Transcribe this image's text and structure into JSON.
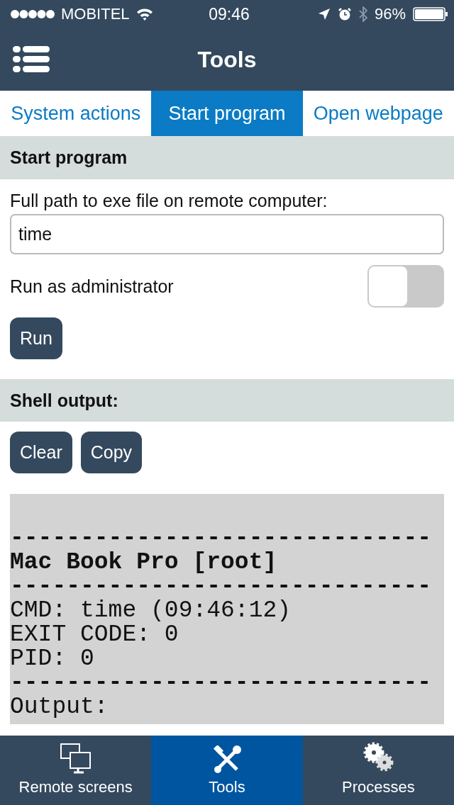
{
  "status_bar": {
    "carrier": "MOBITEL",
    "time": "09:46",
    "battery": "96%"
  },
  "header": {
    "title": "Tools"
  },
  "tabs": [
    {
      "label": "System actions",
      "selected": false
    },
    {
      "label": "Start program",
      "selected": true
    },
    {
      "label": "Open webpage",
      "selected": false
    }
  ],
  "start_program": {
    "title": "Start program",
    "path_label": "Full path to exe file on remote computer:",
    "path_value": "time",
    "admin_label": "Run as administrator",
    "admin_on": false,
    "run_button": "Run"
  },
  "shell": {
    "title": "Shell output:",
    "buttons": [
      "Clear",
      "Copy"
    ],
    "lines": [
      {
        "kind": "rule",
        "text": "------------------------------"
      },
      {
        "kind": "bold",
        "text": "Mac Book Pro [root]"
      },
      {
        "kind": "rule",
        "text": "------------------------------"
      },
      {
        "kind": "text",
        "text": "CMD: time (09:46:12)"
      },
      {
        "kind": "text",
        "text": "EXIT CODE: 0"
      },
      {
        "kind": "text",
        "text": "PID: 0"
      },
      {
        "kind": "rule",
        "text": "------------------------------"
      },
      {
        "kind": "text",
        "text": "Output:"
      }
    ]
  },
  "bottom_tabs": [
    {
      "label": "Remote screens",
      "selected": false
    },
    {
      "label": "Tools",
      "selected": true
    },
    {
      "label": "Processes",
      "selected": false
    }
  ]
}
